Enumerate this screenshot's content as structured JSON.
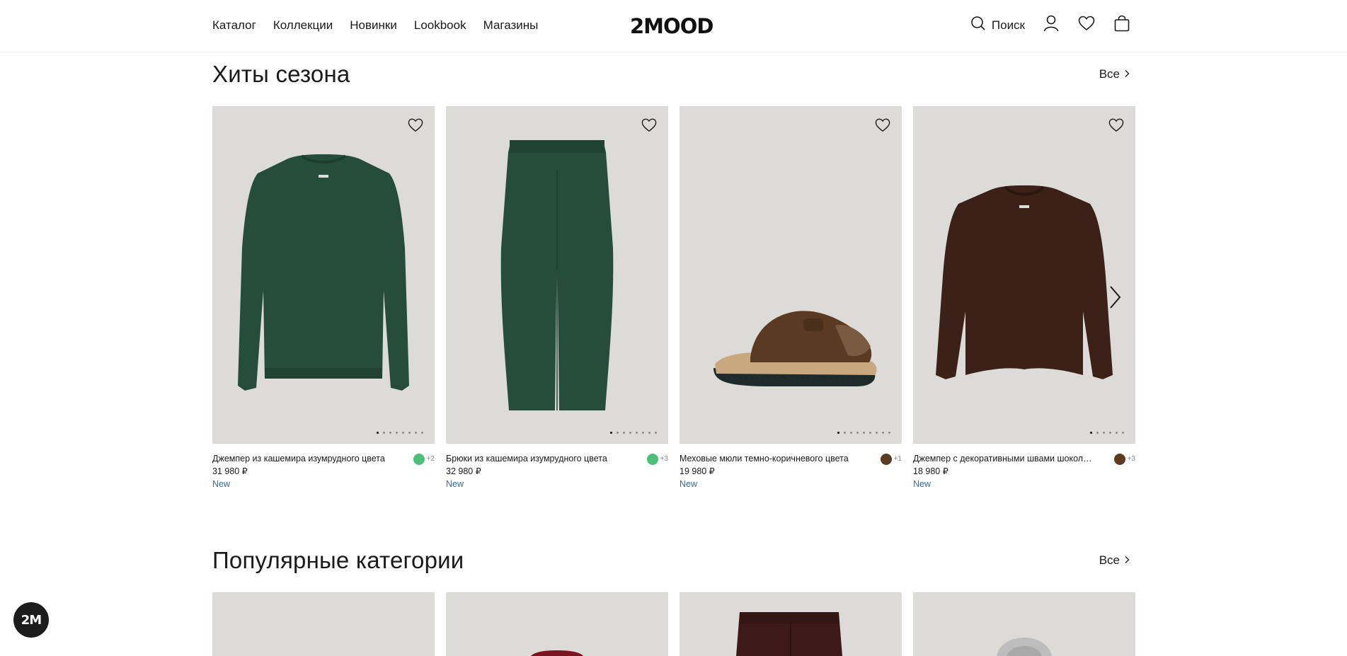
{
  "header": {
    "nav": [
      "Каталог",
      "Коллекции",
      "Новинки",
      "Lookbook",
      "Магазины"
    ],
    "logo": "2MOOD",
    "search_label": "Поиск",
    "icons": [
      "search-icon",
      "user-icon",
      "heart-icon",
      "bag-icon"
    ]
  },
  "hits": {
    "title": "Хиты сезона",
    "all_label": "Все",
    "products": [
      {
        "name": "Джемпер из кашемира изумрудного цвета",
        "price": "31 980 ₽",
        "badge": "New",
        "swatch": "#4cc07a",
        "more": "+2",
        "dots": 8
      },
      {
        "name": "Брюки из кашемира изумрудного цвета",
        "price": "32 980 ₽",
        "badge": "New",
        "swatch": "#4cc07a",
        "more": "+3",
        "dots": 8
      },
      {
        "name": "Меховые мюли темно-коричневого цвета",
        "price": "19 980 ₽",
        "badge": "New",
        "swatch": "#5a3c22",
        "more": "+1",
        "dots": 9
      },
      {
        "name": "Джемпер с декоративными швами шоколадного цвета",
        "price": "18 980 ₽",
        "badge": "New",
        "swatch": "#5a3c22",
        "more": "+3",
        "dots": 6
      }
    ]
  },
  "categories": {
    "title": "Популярные категории",
    "all_label": "Все"
  },
  "chat_badge": "2M",
  "colors": {
    "accent_new": "#2b6fb0",
    "image_bg": "#dcdbd8"
  }
}
